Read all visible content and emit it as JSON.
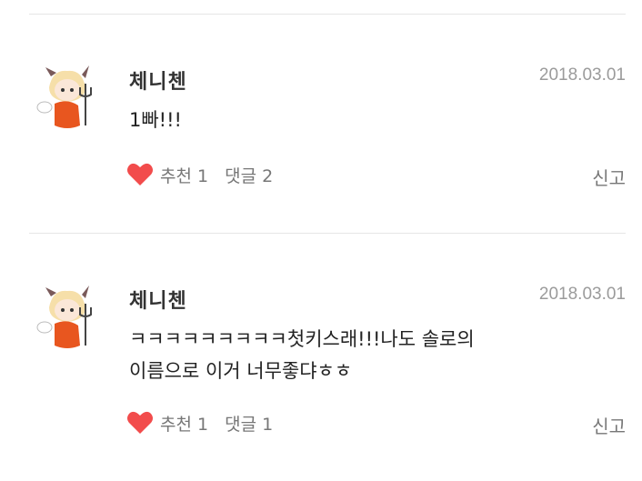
{
  "comments": [
    {
      "author": "체니첸",
      "date": "2018.03.01",
      "text_lines": [
        "1빠!!!"
      ],
      "like_label": "추천 1",
      "reply_label": "댓글 2",
      "report_label": "신고",
      "heart_color": "#f24c4c",
      "avatar_icon": "devil-chibi-avatar"
    },
    {
      "author": "체니첸",
      "date": "2018.03.01",
      "text_lines": [
        "ㅋㅋㅋㅋㅋㅋㅋㅋㅋ첫키스래!!!나도 솔로의",
        "이름으로 이거 너무좋댜ㅎㅎ"
      ],
      "like_label": "추천 1",
      "reply_label": "댓글 1",
      "report_label": "신고",
      "heart_color": "#f24c4c",
      "avatar_icon": "devil-chibi-avatar"
    }
  ]
}
